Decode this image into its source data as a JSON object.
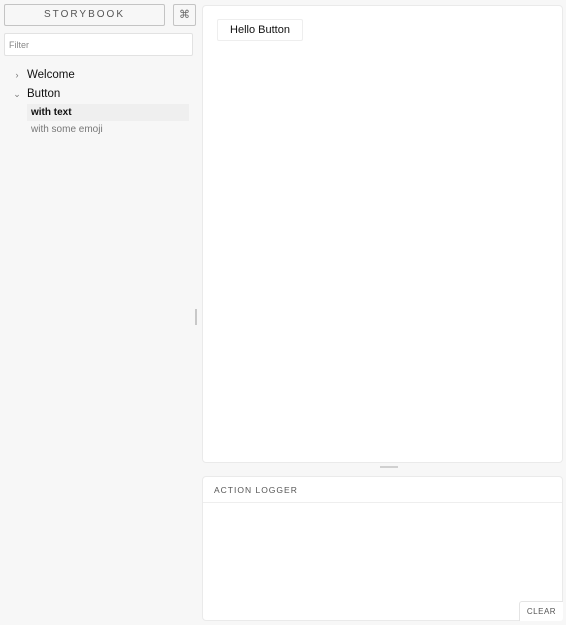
{
  "sidebar": {
    "brand": "STORYBOOK",
    "shortcut_icon": "⌘",
    "filter_placeholder": "Filter",
    "kinds": [
      {
        "label": "Welcome",
        "expanded": false,
        "caret": "›"
      },
      {
        "label": "Button",
        "expanded": true,
        "caret": "⌄",
        "stories": [
          {
            "label": "with text",
            "selected": true
          },
          {
            "label": "with some emoji",
            "selected": false
          }
        ]
      }
    ]
  },
  "preview": {
    "button_label": "Hello Button"
  },
  "action_logger": {
    "title": "ACTION LOGGER",
    "clear_label": "CLEAR"
  }
}
